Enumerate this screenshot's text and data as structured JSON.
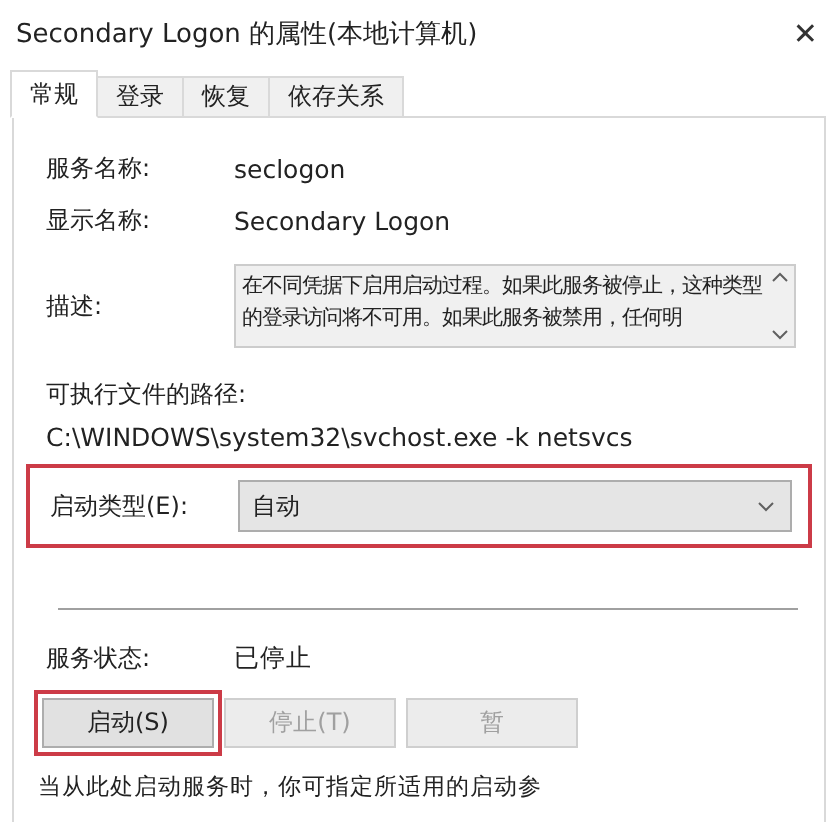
{
  "window": {
    "title": "Secondary Logon 的属性(本地计算机)",
    "close": "✕"
  },
  "tabs": [
    {
      "label": "常规",
      "selected": true
    },
    {
      "label": "登录",
      "selected": false
    },
    {
      "label": "恢复",
      "selected": false
    },
    {
      "label": "依存关系",
      "selected": false
    }
  ],
  "fields": [
    {
      "label": "服务名称:",
      "value": "seclogon"
    },
    {
      "label": "显示名称:",
      "value": "Secondary Logon"
    }
  ],
  "description": {
    "label": "描述:",
    "text": "在不同凭据下启用启动过程。如果此服务被停止，这种类型的登录访问将不可用。如果此服务被禁用，任何明"
  },
  "path": {
    "label": "可执行文件的路径:",
    "value": "C:\\WINDOWS\\system32\\svchost.exe -k netsvcs"
  },
  "startup_type": {
    "label": "启动类型(E):",
    "value": "自动",
    "highlighted": true
  },
  "status": {
    "label": "服务状态:",
    "value": "已停止"
  },
  "buttons": [
    {
      "label": "启动(S)",
      "disabled": false,
      "highlighted": true
    },
    {
      "label": "停止(T)",
      "disabled": true,
      "highlighted": false
    },
    {
      "label": "暂",
      "disabled": true,
      "highlighted": false
    }
  ],
  "hint": "当从此处启动服务时，你可指定所适用的启动参"
}
